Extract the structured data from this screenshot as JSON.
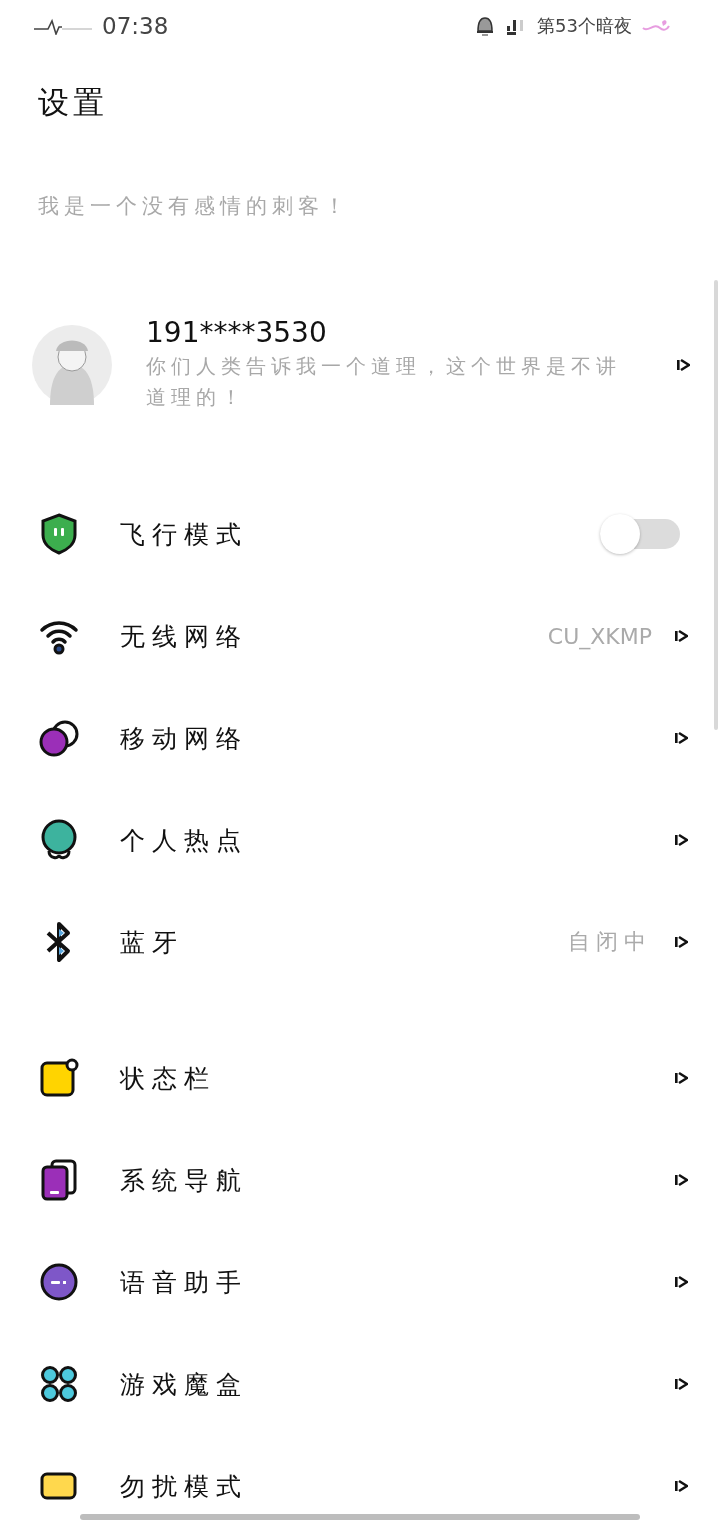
{
  "status_bar": {
    "time": "07:38",
    "carrier_text": "第53个暗夜"
  },
  "title": "设置",
  "motto": "我是一个没有感情的刺客！",
  "profile": {
    "phone": "191****3530",
    "signature": "你们人类告诉我一个道理，这个世界是不讲道理的！"
  },
  "sections": [
    {
      "items": [
        {
          "kind": "toggle",
          "label": "飞行模式",
          "on": false
        },
        {
          "kind": "link",
          "label": "无线网络",
          "value": "CU_XKMP"
        },
        {
          "kind": "link",
          "label": "移动网络"
        },
        {
          "kind": "link",
          "label": "个人热点"
        },
        {
          "kind": "link",
          "label": "蓝牙",
          "value": "自闭中"
        }
      ]
    },
    {
      "items": [
        {
          "kind": "link",
          "label": "状态栏"
        },
        {
          "kind": "link",
          "label": "系统导航"
        },
        {
          "kind": "link",
          "label": "语音助手"
        },
        {
          "kind": "link",
          "label": "游戏魔盒"
        },
        {
          "kind": "link",
          "label": "勿扰模式"
        }
      ]
    }
  ]
}
